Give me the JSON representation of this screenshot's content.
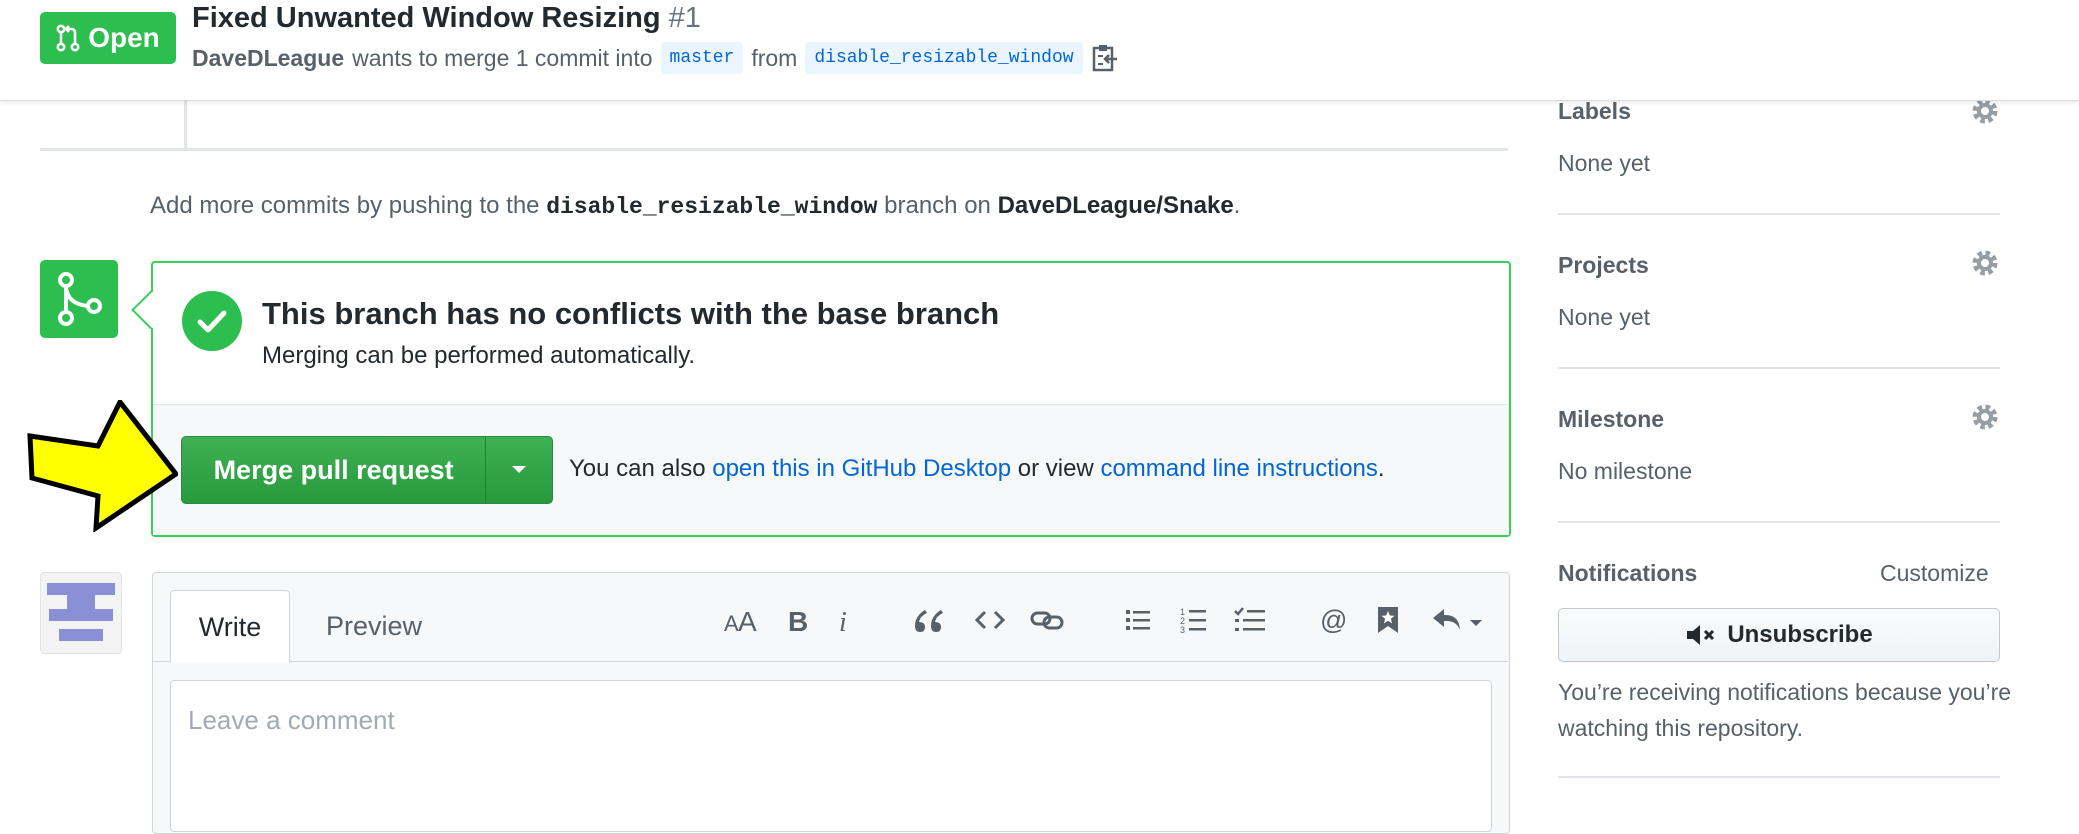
{
  "header": {
    "status_badge": "Open",
    "title": "Fixed Unwanted Window Resizing",
    "number": "#1",
    "author": "DaveDLeague",
    "merge_text": "wants to merge 1 commit into",
    "base_branch": "master",
    "from_text": "from",
    "head_branch": "disable_resizable_window"
  },
  "timeline": {
    "add_commits_prefix": "Add more commits by pushing to the",
    "add_commits_branch": "disable_resizable_window",
    "add_commits_middle": "branch on",
    "add_commits_repo": "DaveDLeague/Snake",
    "add_commits_suffix": "."
  },
  "merge": {
    "title": "This branch has no conflicts with the base branch",
    "subtitle": "Merging can be performed automatically.",
    "button_label": "Merge pull request",
    "alt_prefix": "You can also",
    "alt_link_desktop": "open this in GitHub Desktop",
    "alt_middle": "or view",
    "alt_link_cli": "command line instructions",
    "alt_suffix": "."
  },
  "comment": {
    "tab_write": "Write",
    "tab_preview": "Preview",
    "placeholder": "Leave a comment",
    "toolbar": [
      "text-size-icon",
      "bold-icon",
      "italic-icon",
      "quote-icon",
      "code-icon",
      "link-icon",
      "bullet-list-icon",
      "numbered-list-icon",
      "task-list-icon",
      "mention-icon",
      "saved-reply-icon",
      "reply-icon"
    ]
  },
  "sidebar": {
    "labels_heading": "Labels",
    "labels_value": "None yet",
    "projects_heading": "Projects",
    "projects_value": "None yet",
    "milestone_heading": "Milestone",
    "milestone_value": "No milestone",
    "notifications_heading": "Notifications",
    "customize": "Customize",
    "unsubscribe": "Unsubscribe",
    "notifications_desc": "You’re receiving notifications because you’re watching this repository."
  },
  "colors": {
    "success": "#2cbe4e",
    "link": "#0366d6",
    "arrow": "#ffff00"
  }
}
